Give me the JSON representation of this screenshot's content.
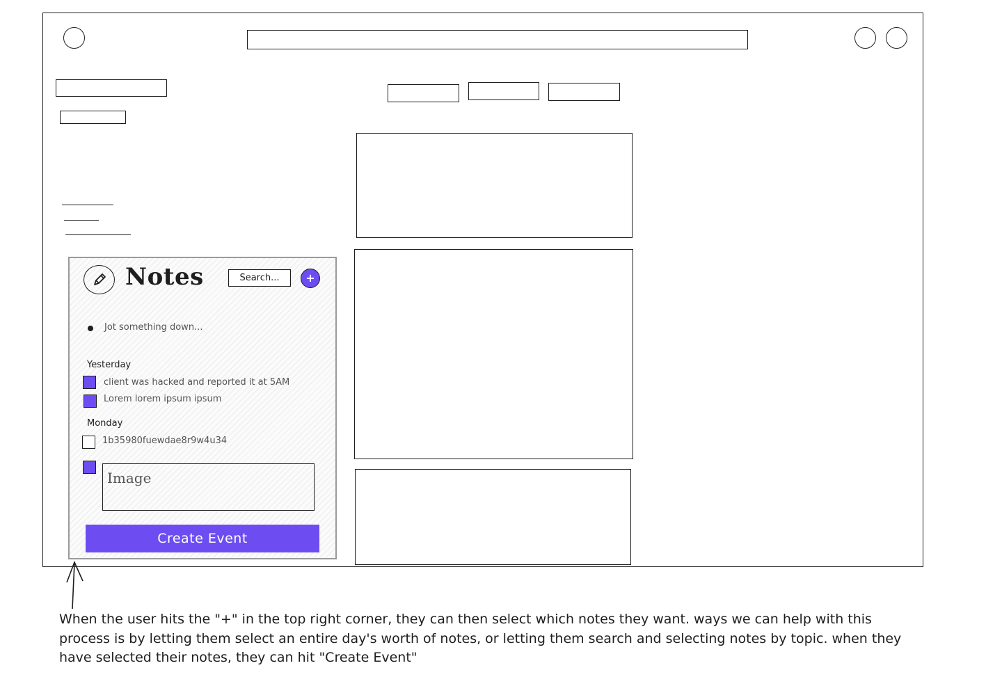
{
  "notes": {
    "title": "Notes",
    "search_placeholder": "Search...",
    "add_label": "+",
    "input_placeholder": "Jot something down...",
    "groups": [
      {
        "heading": "Yesterday",
        "items": [
          {
            "text": "client was hacked and reported it at 5AM",
            "checked": true
          },
          {
            "text": "Lorem lorem ipsum ipsum",
            "checked": true
          }
        ]
      },
      {
        "heading": "Monday",
        "items": [
          {
            "text": "1b35980fuewdae8r9w4u34",
            "checked": false
          }
        ]
      }
    ],
    "image_label": "Image",
    "image_checked": true,
    "create_button": "Create Event"
  },
  "annotation": "When the user hits the \"+\" in the top right corner, they can then select which notes they want. ways we can help with this process is by letting them select an entire day's worth of notes, or letting them search and selecting notes by topic. when they have selected their notes, they can hit \"Create Event\"",
  "colors": {
    "accent": "#6d4df2"
  }
}
